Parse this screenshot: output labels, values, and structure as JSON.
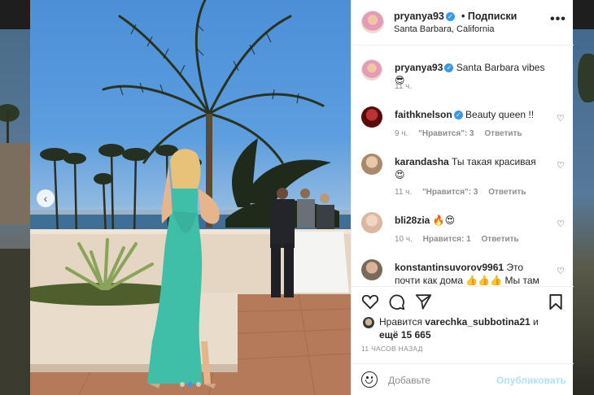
{
  "post": {
    "username": "pryanya93",
    "follow_label": "• Подписки",
    "location": "Santa Barbara, California",
    "more_label": "•••",
    "carousel_prev_label": "‹"
  },
  "caption": {
    "username": "pryanya93",
    "text": "Santa Barbara vibes 😎",
    "time": "11 ч."
  },
  "comments": [
    {
      "username": "faithknelson",
      "verified": true,
      "text": "Beauty queen !!",
      "time": "9 ч.",
      "likes": "\"Нравится\": 3",
      "reply": "Ответить"
    },
    {
      "username": "karandasha",
      "verified": false,
      "text": "Ты такая красивая",
      "text2": "😍",
      "time": "11 ч.",
      "likes": "\"Нравится\": 3",
      "reply": "Ответить"
    },
    {
      "username": "bli28zia",
      "verified": false,
      "text": "🔥😍",
      "time": "10 ч.",
      "likes": "Нравится: 1",
      "reply": "Ответить"
    },
    {
      "username": "konstantinsuvorov9961",
      "verified": false,
      "text": "Это",
      "text2": "почти как дома 👍👍👍 Мы там"
    }
  ],
  "likes": {
    "prefix": "Нравится",
    "user": "varechka_subbotina21",
    "mid": "и",
    "more_prefix": "ещё",
    "count": "15 665"
  },
  "time_ago": "11 ЧАСОВ НАЗАД",
  "composer": {
    "placeholder": "Добавьте",
    "post_label": "Опубликовать"
  },
  "icons": {
    "verified": "verified-badge-icon",
    "heart": "heart-icon",
    "comment": "comment-icon",
    "share": "share-icon",
    "save": "bookmark-icon",
    "emoji": "smiley-icon"
  },
  "colors": {
    "verified": "#3897f0",
    "link_disabled": "#b2dffc",
    "meta": "#8e8e8e"
  },
  "carousel": {
    "slides": 3,
    "active": 1
  }
}
